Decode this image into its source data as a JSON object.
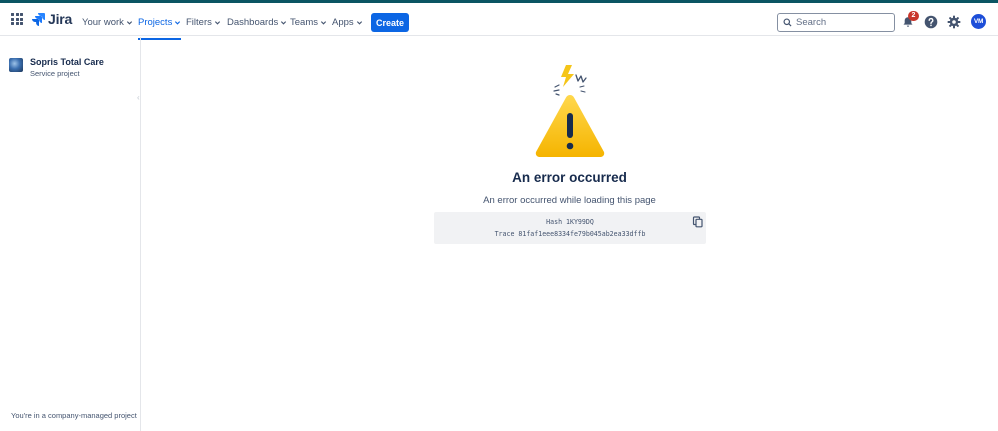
{
  "topnav": {
    "logo_text": "Jira",
    "items": [
      {
        "label": "Your work"
      },
      {
        "label": "Projects"
      },
      {
        "label": "Filters"
      },
      {
        "label": "Dashboards"
      },
      {
        "label": "Teams"
      },
      {
        "label": "Apps"
      }
    ],
    "create_label": "Create",
    "search_placeholder": "Search",
    "notification_count": "2",
    "avatar_initials": "VM",
    "icons": [
      "app-switcher-icon",
      "jira-logo-icon",
      "chevron-down-icon",
      "search-icon",
      "bell-icon",
      "help-icon",
      "gear-icon"
    ]
  },
  "sidebar": {
    "project_name": "Sopris Total Care",
    "project_type": "Service project",
    "footer": "You're in a company-managed project"
  },
  "main": {
    "title": "An error occurred",
    "description": "An error occurred while loading this page",
    "hash": "Hash 1KY99DQ",
    "trace": "Trace 81faf1eee8334fe79b045ab2ea33dffb"
  },
  "colors": {
    "accent": "#0c66e4",
    "top_stripe": "#0b5563",
    "warning": "#f5c518",
    "badge": "#c9372c"
  }
}
